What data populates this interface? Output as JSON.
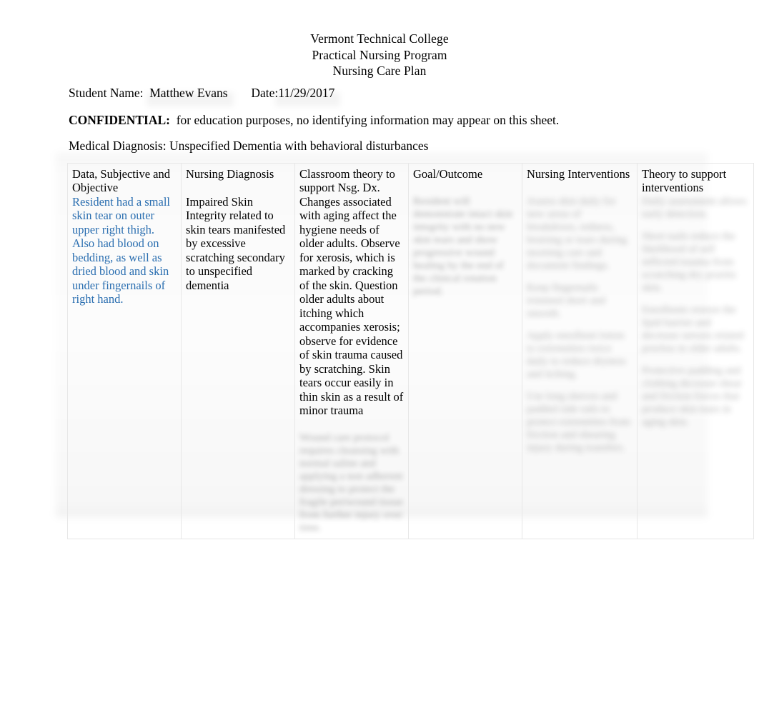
{
  "document": {
    "institution": "Vermont Technical College",
    "program": "Practical Nursing Program",
    "form_title": "Nursing Care Plan"
  },
  "student_info": {
    "name_label": "Student Name:",
    "name_value": "Matthew Evans",
    "date_label": "Date:",
    "date_value": "11/29/2017"
  },
  "confidential": {
    "label": "CONFIDENTIAL:",
    "text": "for education purposes, no identifying information may appear on this sheet."
  },
  "diagnosis": {
    "label": "Medical Diagnosis:",
    "value": "Unspecified Dementia with behavioral disturbances",
    "full": "Medical Diagnosis: Unspecified Dementia with behavioral disturbances"
  },
  "care_plan_table": {
    "headers": [
      "Data, Subjective and Objective",
      "Nursing Diagnosis",
      "Classroom theory to support Nsg. Dx.",
      "Goal/Outcome",
      "Nursing Interventions",
      "Theory to support interventions"
    ],
    "cells": {
      "data_subjective_objective": "Resident had a small skin tear on outer upper right thigh.  Also had blood on bedding, as well as dried blood and skin under fingernails of right hand.",
      "nursing_diagnosis": "Impaired Skin Integrity related to skin tears manifested by excessive scratching secondary to unspecified dementia",
      "classroom_theory": "Changes associated with aging affect the hygiene needs of older adults.  Observe for xerosis, which is marked by cracking of the skin.  Question older adults about itching which accompanies xerosis; observe for evidence of skin trauma caused by scratching.  Skin tears occur easily in thin skin as a result of minor trauma",
      "classroom_theory_redacted": "illegible blurred paragraph",
      "goal_outcome_redacted": "illegible blurred paragraph",
      "nursing_interventions_redacted": "illegible blurred paragraphs",
      "theory_support_redacted": "illegible blurred paragraphs"
    }
  },
  "colors": {
    "blue_text": "#2a6eb0",
    "body_text": "#000000",
    "table_border": "#e7e7e7",
    "page_background": "#ffffff"
  }
}
